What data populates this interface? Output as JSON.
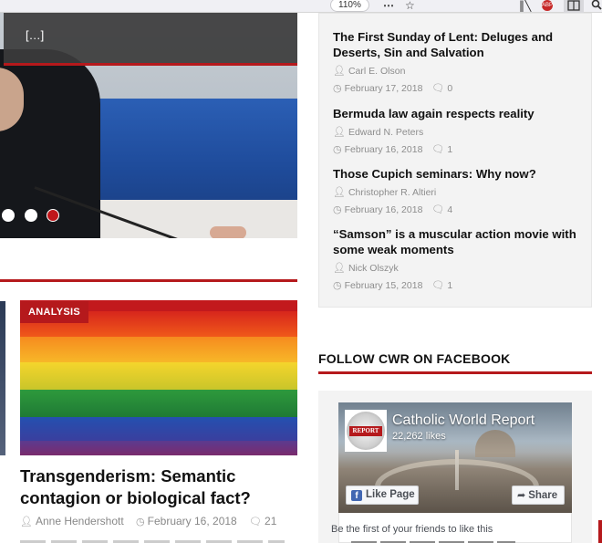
{
  "browser": {
    "zoom": "110%",
    "more_icon": "⋯",
    "star_icon": "☆",
    "library_icon": "library-icon",
    "extension_badge": "ABP",
    "reader_icon": "reader-view-icon",
    "search_icon": "search-icon"
  },
  "slider": {
    "caption_more": "[…]",
    "dots": [
      "inactive",
      "inactive",
      "active"
    ]
  },
  "feature": {
    "badge": "ANALYSIS",
    "title": "Transgenderism: Semantic contagion or biological fact?",
    "author": "Anne Hendershott",
    "date": "February 16, 2018",
    "comments": "21"
  },
  "recent_posts": [
    {
      "title": "The First Sunday of Lent: Deluges and Deserts, Sin and Salvation",
      "author": "Carl E. Olson",
      "date": "February 17, 2018",
      "comments": "0"
    },
    {
      "title": "Bermuda law again respects reality",
      "author": "Edward N. Peters",
      "date": "February 16, 2018",
      "comments": "1"
    },
    {
      "title": "Those Cupich seminars: Why now?",
      "author": "Christopher R. Altieri",
      "date": "February 16, 2018",
      "comments": "4"
    },
    {
      "title": "“Samson” is a muscular action movie with some weak moments",
      "author": "Nick Olszyk",
      "date": "February 15, 2018",
      "comments": "1"
    }
  ],
  "facebook": {
    "heading": "FOLLOW CWR ON FACEBOOK",
    "page_name": "Catholic World Report",
    "likes": "22,262 likes",
    "logo_text": "REPORT",
    "like_button": "Like Page",
    "share_button": "Share",
    "friends_text": "Be the first of your friends to like this"
  },
  "colors": {
    "accent": "#b5191c",
    "facebook_blue": "#4267b2"
  }
}
